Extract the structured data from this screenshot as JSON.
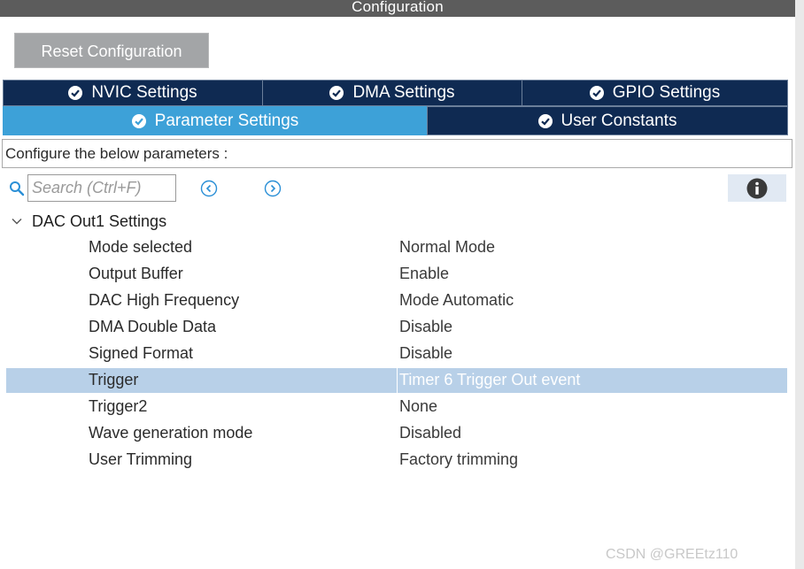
{
  "window": {
    "title": "Configuration"
  },
  "toolbar": {
    "reset_label": "Reset Configuration"
  },
  "tabs": [
    {
      "label": "NVIC Settings",
      "active": false,
      "icon": "check-circle-icon"
    },
    {
      "label": "DMA Settings",
      "active": false,
      "icon": "check-circle-icon"
    },
    {
      "label": "GPIO Settings",
      "active": false,
      "icon": "check-circle-icon"
    },
    {
      "label": "Parameter Settings",
      "active": true,
      "icon": "check-circle-icon"
    },
    {
      "label": "User Constants",
      "active": false,
      "icon": "check-circle-icon"
    }
  ],
  "description": "Configure the below parameters :",
  "search": {
    "placeholder": "Search (Ctrl+F)",
    "value": ""
  },
  "group": {
    "title": "DAC Out1 Settings",
    "expanded": true
  },
  "parameters": [
    {
      "name": "Mode selected",
      "value": "Normal Mode",
      "selected": false
    },
    {
      "name": "Output Buffer",
      "value": "Enable",
      "selected": false
    },
    {
      "name": "DAC High Frequency",
      "value": "Mode Automatic",
      "selected": false
    },
    {
      "name": "DMA Double Data",
      "value": "Disable",
      "selected": false
    },
    {
      "name": "Signed Format",
      "value": "Disable",
      "selected": false
    },
    {
      "name": "Trigger",
      "value": "Timer 6 Trigger Out event",
      "selected": true
    },
    {
      "name": "Trigger2",
      "value": "None",
      "selected": false
    },
    {
      "name": "Wave generation mode",
      "value": "Disabled",
      "selected": false
    },
    {
      "name": "User Trimming",
      "value": "Factory trimming",
      "selected": false
    }
  ],
  "watermark": "CSDN @GREEtz110",
  "colors": {
    "tab_inactive": "#0f2a52",
    "tab_active": "#3da1d8",
    "selected_row": "#b8d0e8",
    "title_bar": "#5c5c5c"
  }
}
